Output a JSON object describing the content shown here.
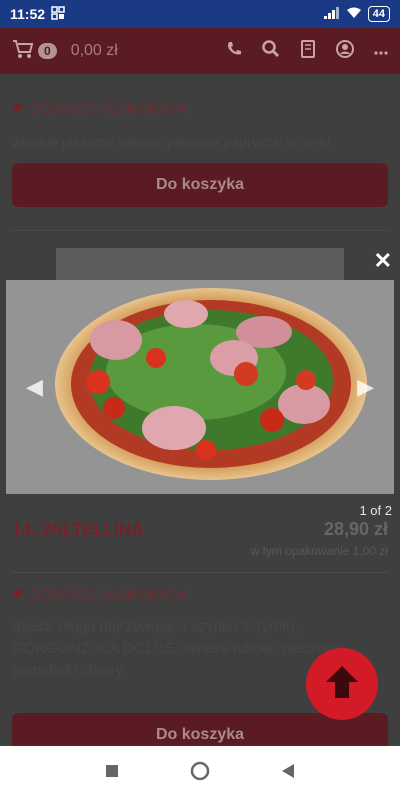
{
  "status_bar": {
    "time": "11:52",
    "battery": "44"
  },
  "header": {
    "cart_count": "0",
    "cart_total": "0,00 zł"
  },
  "prev_item": {
    "favorite_label": "DODAJ DO ULUBIONYCH",
    "description": "włoskie pikantne salami, pikantne papryczki w oleju",
    "button_label": "Do koszyka"
  },
  "lightbox": {
    "counter": "1 of 2"
  },
  "product": {
    "title": "14. VALTELLINA",
    "price": "28,90 zł",
    "packaging": "w tym opakowanie 1,00 zł",
    "favorite_label": "DODAJ DO ULUBIONYCH",
    "description": "Speck-długo dojrzewająca szynka z Tyrolu, GORGONZOLA DOLCE, świeża rukola, pieczone pomidorki cherry",
    "button_label": "Do koszyka"
  },
  "colors": {
    "brand": "#b11f2b",
    "fab": "#d31b27"
  }
}
